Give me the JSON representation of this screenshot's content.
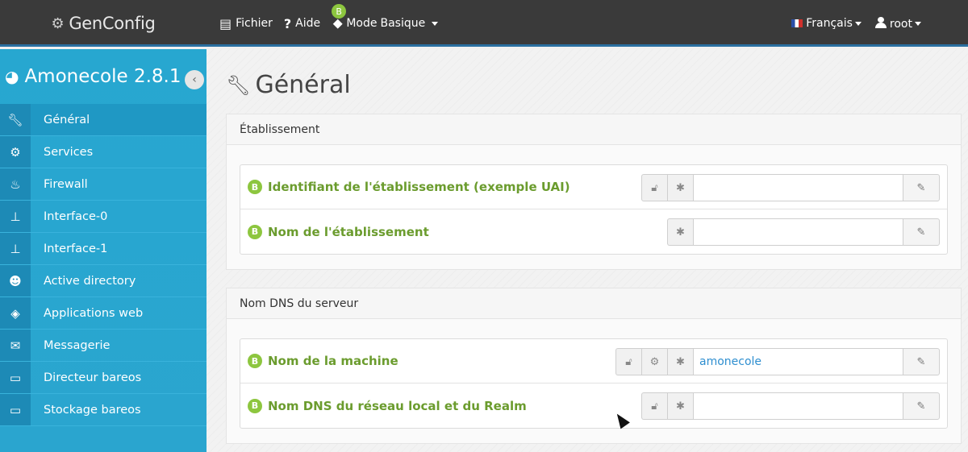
{
  "topbar": {
    "brand": "GenConfig",
    "menu": {
      "fichier": "Fichier",
      "aide": "Aide",
      "mode_prefix": "Mode",
      "mode_value": "Basique",
      "mode_badge": "B"
    },
    "language": "Français",
    "user": "root"
  },
  "sidebar": {
    "title": "Amonecole 2.8.1",
    "items": [
      {
        "label": "Général",
        "icon": "wrench-icon"
      },
      {
        "label": "Services",
        "icon": "gears-icon"
      },
      {
        "label": "Firewall",
        "icon": "fire-icon"
      },
      {
        "label": "Interface-0",
        "icon": "sitemap-icon"
      },
      {
        "label": "Interface-1",
        "icon": "sitemap-icon"
      },
      {
        "label": "Active directory",
        "icon": "users-icon"
      },
      {
        "label": "Applications web",
        "icon": "html5-icon"
      },
      {
        "label": "Messagerie",
        "icon": "envelope-icon"
      },
      {
        "label": "Directeur bareos",
        "icon": "archive-icon"
      },
      {
        "label": "Stockage bareos",
        "icon": "archive-icon"
      }
    ]
  },
  "main": {
    "title": "Général",
    "sections": [
      {
        "heading": "Établissement",
        "fields": [
          {
            "badge": "B",
            "label": "Identifiant de l'établissement (exemple UAI)",
            "value": ""
          },
          {
            "badge": "B",
            "label": "Nom de l'établissement",
            "value": ""
          }
        ]
      },
      {
        "heading": "Nom DNS du serveur",
        "fields": [
          {
            "badge": "B",
            "label": "Nom de la machine",
            "value": "amonecole"
          },
          {
            "badge": "B",
            "label": "Nom DNS du réseau local et du Realm",
            "value": ""
          }
        ]
      }
    ]
  },
  "colors": {
    "topbar": "#3a3a3a",
    "sidebar": "#27a7d0",
    "badge": "#8dc63f",
    "label": "#6b9c2e",
    "value": "#2f8fd0"
  }
}
